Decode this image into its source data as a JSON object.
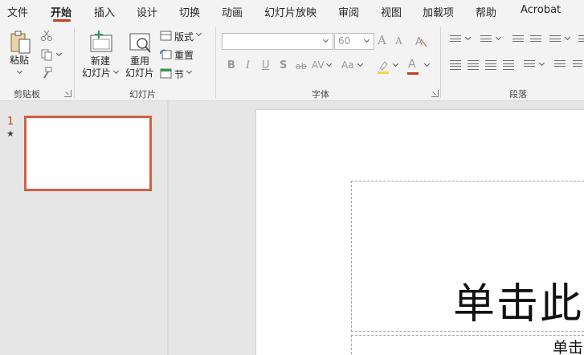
{
  "menu": {
    "tabs": [
      {
        "label": "文件"
      },
      {
        "label": "开始"
      },
      {
        "label": "插入"
      },
      {
        "label": "设计"
      },
      {
        "label": "切换"
      },
      {
        "label": "动画"
      },
      {
        "label": "幻灯片放映"
      },
      {
        "label": "审阅"
      },
      {
        "label": "视图"
      },
      {
        "label": "加载项"
      },
      {
        "label": "帮助"
      },
      {
        "label": "Acrobat"
      }
    ],
    "active_tab": "开始"
  },
  "ribbon": {
    "clipboard": {
      "paste_label": "粘贴",
      "group_label": "剪贴板"
    },
    "slides": {
      "new_slide_line1": "新建",
      "new_slide_line2": "幻灯片",
      "reuse_line1": "重用",
      "reuse_line2": "幻灯片",
      "layout_label": "版式",
      "reset_label": "重置",
      "section_label": "节",
      "group_label": "幻灯片"
    },
    "font": {
      "font_name_value": "",
      "font_size_value": "60",
      "bold": "B",
      "italic": "I",
      "underline": "U",
      "shadow": "S",
      "strike": "ab",
      "spacing": "AV",
      "case": "Aa",
      "grow": "A",
      "shrink": "A",
      "color_a": "A",
      "group_label": "字体"
    },
    "paragraph": {
      "group_label": "段落"
    }
  },
  "thumbnails": {
    "slide_number": "1",
    "star": "★"
  },
  "slide": {
    "title_placeholder": "单击此",
    "subtitle_placeholder": "单击"
  },
  "colors": {
    "accent": "#c43e1c",
    "thumb_border": "#d35f45"
  }
}
